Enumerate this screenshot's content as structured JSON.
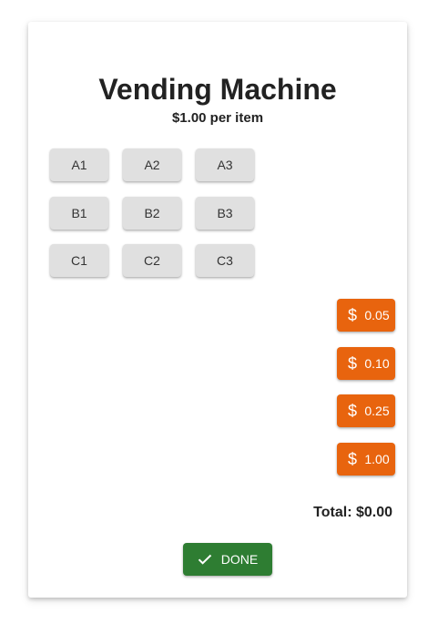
{
  "title": "Vending Machine",
  "price_label": "$1.00 per item",
  "slots": {
    "a1": "A1",
    "a2": "A2",
    "a3": "A3",
    "b1": "B1",
    "b2": "B2",
    "b3": "B3",
    "c1": "C1",
    "c2": "C2",
    "c3": "C3"
  },
  "coins": {
    "currency_symbol": "$",
    "c005": "0.05",
    "c010": "0.10",
    "c025": "0.25",
    "c100": "1.00"
  },
  "total_label": "Total: $0.00",
  "done_label": "DONE",
  "done_icon": "check-icon",
  "colors": {
    "coin_button": "#e8640e",
    "done_button": "#2e7d32",
    "slot_button": "#e0e0e0"
  }
}
